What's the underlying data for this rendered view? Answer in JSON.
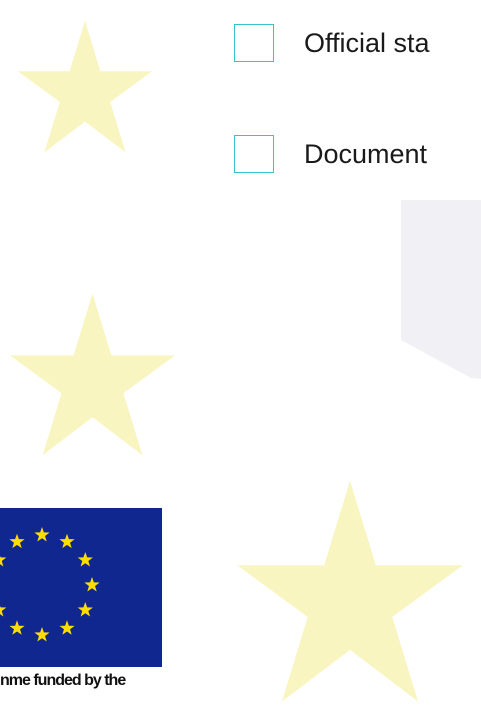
{
  "checkboxes": [
    {
      "label": "Official sta",
      "checked": false
    },
    {
      "label": "Document",
      "checked": false
    }
  ],
  "eu_logo": {
    "caption": "nme funded by the",
    "flag_color": "#10278f",
    "star_color": "#ffdd00"
  },
  "colors": {
    "background_star": "#f9f5c1",
    "checkbox_border": "#39c2c9",
    "panel": "#f1f1f5"
  }
}
